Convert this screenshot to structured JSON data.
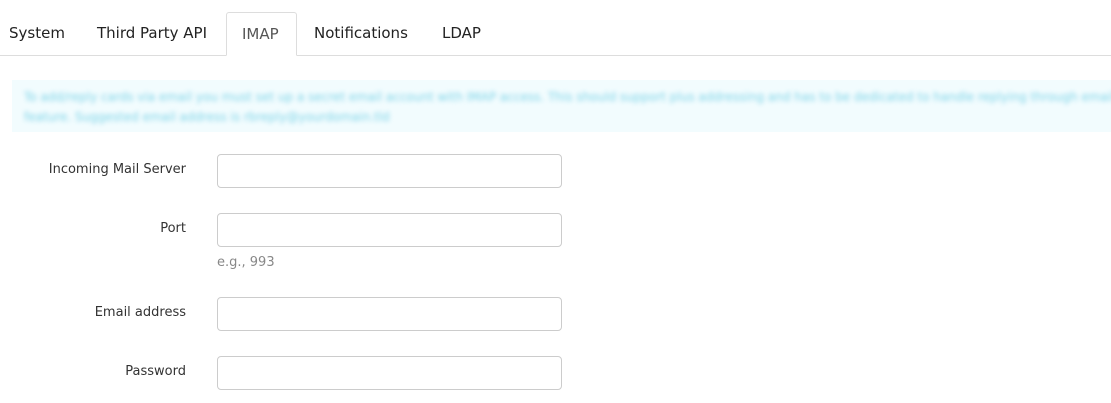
{
  "tabs": [
    "System",
    "Third Party API",
    "IMAP",
    "Notifications",
    "LDAP"
  ],
  "active_tab": "IMAP",
  "info_text": "To add/reply cards via email you must set up a secret email account with IMAP access. This should support plus addressing and has to be dedicated to handle replying through email feature. Suggested email address is rbreply@yourdomain.tld",
  "fields": [
    {
      "label": "Incoming Mail Server",
      "value": ""
    },
    {
      "label": "Port",
      "value": "",
      "help": "e.g., 993"
    },
    {
      "label": "Email address",
      "value": ""
    },
    {
      "label": "Password",
      "value": ""
    }
  ]
}
